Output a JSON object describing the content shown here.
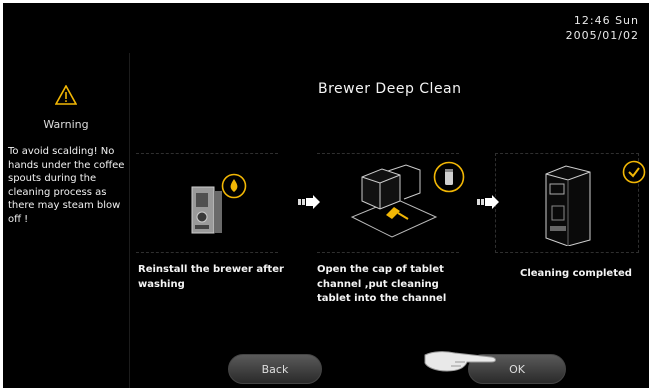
{
  "clock": {
    "time": "12:46  Sun",
    "date": "2005/01/02"
  },
  "sidebar": {
    "warning_title": "Warning",
    "warning_text": "To avoid scalding! No hands under the coffee spouts during the cleaning process as there may steam blow off !"
  },
  "title": "Brewer Deep Clean",
  "steps": [
    {
      "icon": "brewer-unit-icon",
      "badge": "drop-icon",
      "text": "Reinstall the brewer after washing"
    },
    {
      "icon": "tablet-channel-icon",
      "badge": "tablet-icon",
      "text": "Open the cap of tablet channel ,put cleaning tablet into the channel"
    },
    {
      "icon": "coffee-machine-icon",
      "badge": "check-icon",
      "text": "Cleaning completed"
    }
  ],
  "buttons": {
    "back": "Back",
    "ok": "OK"
  },
  "colors": {
    "accent": "#f2b705",
    "background": "#000000"
  }
}
